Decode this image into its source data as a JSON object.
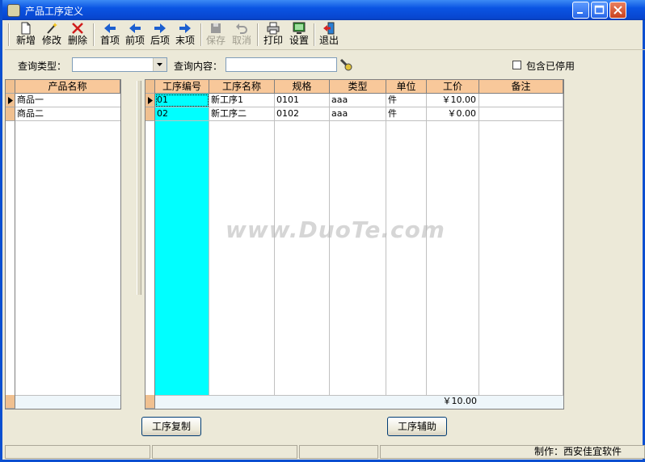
{
  "window": {
    "title": "产品工序定义"
  },
  "toolbar": {
    "add": "新增",
    "edit": "修改",
    "delete": "删除",
    "first": "首项",
    "prev": "前项",
    "next": "后项",
    "last": "末项",
    "save": "保存",
    "cancel": "取消",
    "print": "打印",
    "settings": "设置",
    "exit": "退出"
  },
  "query": {
    "type_label": "查询类型：",
    "type_value": "",
    "content_label": "查询内容：",
    "content_value": "",
    "include_disabled_label": "包含已停用",
    "include_disabled_checked": false
  },
  "products": {
    "header": "产品名称",
    "rows": [
      "商品一",
      "商品二"
    ]
  },
  "process_grid": {
    "headers": [
      "工序编号",
      "工序名称",
      "规格",
      "类型",
      "单位",
      "工价",
      "备注"
    ],
    "rows": [
      {
        "code": "01",
        "name": "新工序1",
        "spec": "0101",
        "type": "aaa",
        "unit": "件",
        "price": "￥10.00",
        "note": ""
      },
      {
        "code": "02",
        "name": "新工序二",
        "spec": "0102",
        "type": "aaa",
        "unit": "件",
        "price": "￥0.00",
        "note": ""
      }
    ],
    "total_price": "￥10.00"
  },
  "buttons": {
    "copy": "工序复制",
    "assist": "工序辅助"
  },
  "statusbar": {
    "credit": "制作：西安佳宜软件"
  },
  "watermark": {
    "text": "www.DuoTe.com"
  },
  "colors": {
    "titlebar": "#0a54e3",
    "header": "#f8c89a",
    "code_column": "#00ffff"
  }
}
